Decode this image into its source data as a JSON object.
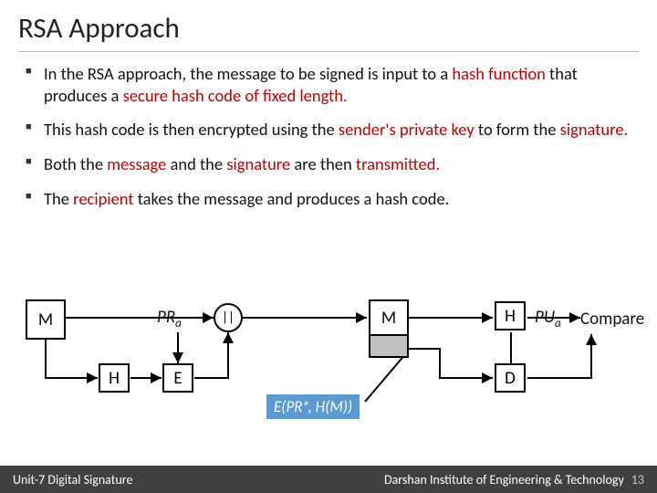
{
  "title": "RSA Approach",
  "bullets": [
    {
      "pre": "In the RSA approach, the message to be signed is input to a ",
      "hl1": "hash function",
      "mid": " that produces a ",
      "hl2": "secure hash code of fixed length.",
      "post": ""
    },
    {
      "pre": "This hash code is then encrypted using the ",
      "hl1": "sender's private key",
      "mid": " to form the ",
      "hl2": "signature.",
      "post": ""
    },
    {
      "pre": "Both the ",
      "hl1": "message",
      "mid": " and the ",
      "hl2": "signature",
      "post": " are then ",
      "hl3": "transmitted."
    },
    {
      "pre": "The ",
      "hl1": "recipient",
      "mid": " takes the message and  produces a hash code.",
      "hl2": "",
      "post": ""
    }
  ],
  "diagram": {
    "m1": "M",
    "h1": "H",
    "pra": "PR",
    "pra_sub": "a",
    "e": "E",
    "concat": "||",
    "m2": "M",
    "h2": "H",
    "pua": "PU",
    "pua_sub": "a",
    "d": "D",
    "compare": "Compare",
    "annot": "E(PRₐ, H(M))"
  },
  "footer": {
    "left": "Unit-7  Digital Signature",
    "right": "Darshan Institute of Engineering & Technology",
    "page": "13"
  }
}
